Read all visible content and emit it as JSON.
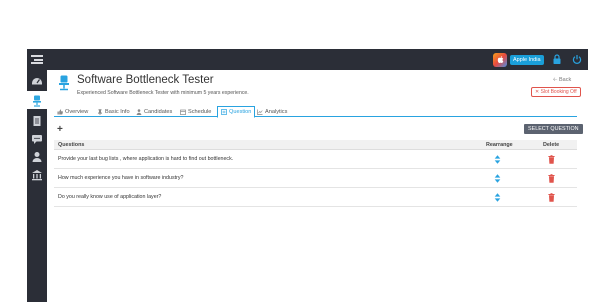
{
  "topbar": {
    "brand_name": "Apple India",
    "accent": "#29a3e0",
    "bg": "#2b2e37"
  },
  "sidebar": {
    "items": [
      {
        "icon": "dashboard-icon"
      },
      {
        "icon": "chair-icon",
        "active": true
      },
      {
        "icon": "document-icon"
      },
      {
        "icon": "chat-icon"
      },
      {
        "icon": "user-icon"
      },
      {
        "icon": "bank-icon"
      }
    ]
  },
  "header": {
    "title": "Software Bottleneck Tester",
    "description": "Experienced Software Bottleneck Tester with minimum 5 years experience.",
    "back_label": "Back",
    "slot_badge": "Slot Booking Off"
  },
  "tabs": [
    {
      "label": "Overview",
      "icon": "thumb-icon"
    },
    {
      "label": "Basic Info",
      "icon": "pin-icon"
    },
    {
      "label": "Candidates",
      "icon": "person-icon"
    },
    {
      "label": "Schedule",
      "icon": "calendar-icon"
    },
    {
      "label": "Question",
      "icon": "list-icon",
      "active": true
    },
    {
      "label": "Analytics",
      "icon": "chart-icon"
    }
  ],
  "toolbar": {
    "add_label": "+",
    "select_question_label": "SELECT QUESTION"
  },
  "table": {
    "headers": {
      "question": "Questions",
      "rearrange": "Rearrange",
      "delete": "Delete"
    },
    "rows": [
      {
        "question": "Provide your last bug lists , where application is hard to find out bottleneck."
      },
      {
        "question": "How much experience you have in software industry?"
      },
      {
        "question": "Do you really know use of application layer?"
      }
    ]
  }
}
